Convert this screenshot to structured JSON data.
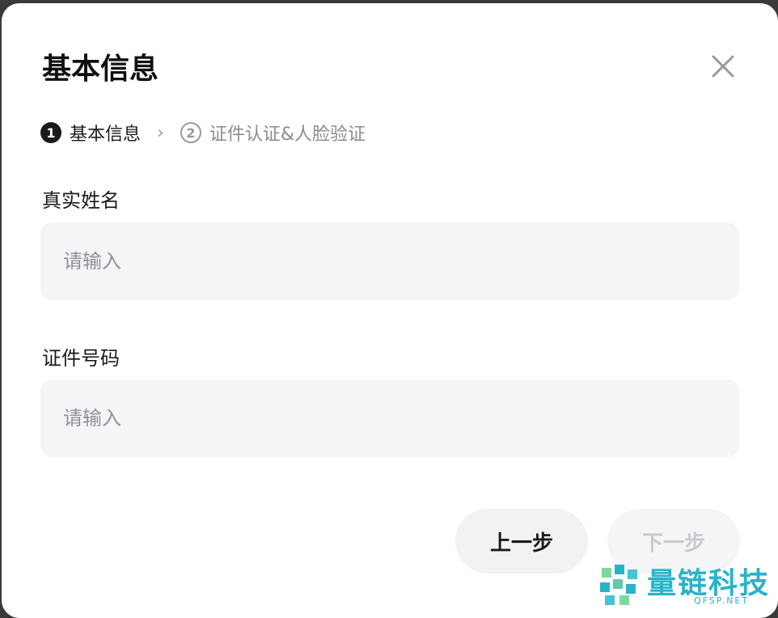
{
  "background": {
    "partial_text": ""
  },
  "dialog": {
    "title": "基本信息",
    "steps": [
      {
        "num": "1",
        "label": "基本信息",
        "state": "active"
      },
      {
        "num": "2",
        "label": "证件认证&人脸验证",
        "state": "inactive"
      }
    ],
    "step_separator": "›",
    "fields": [
      {
        "label": "真实姓名",
        "placeholder": "请输入",
        "value": ""
      },
      {
        "label": "证件号码",
        "placeholder": "请输入",
        "value": ""
      }
    ],
    "buttons": {
      "prev": "上一步",
      "next": "下一步"
    }
  },
  "watermark": {
    "text": "量链科技",
    "url": "QFSP.NET"
  },
  "colors": {
    "accent": "#1a1a1a",
    "input_bg": "#f4f5f7",
    "disabled_text": "#c7c9cd",
    "watermark": "#2ab3c7"
  }
}
